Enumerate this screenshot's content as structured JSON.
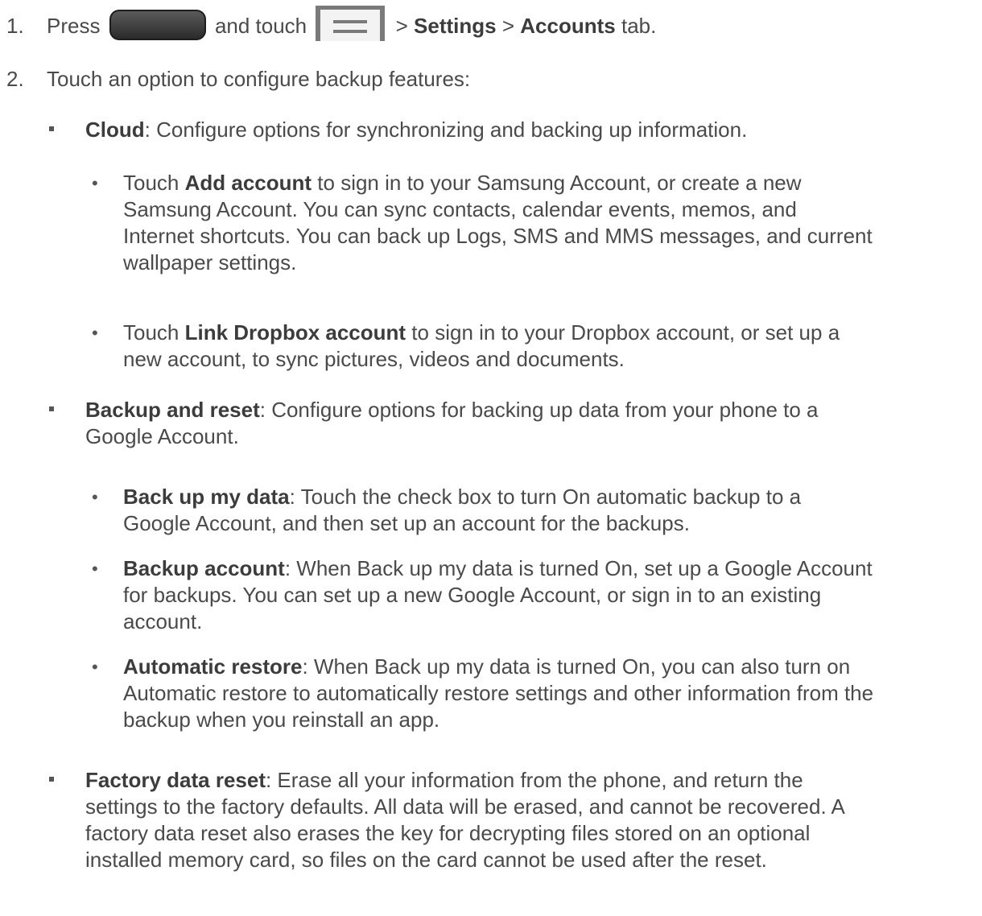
{
  "steps": [
    {
      "num": "1.",
      "parts": {
        "press": "Press",
        "and_touch": "and touch",
        "sep1": ">",
        "settings": "Settings",
        "sep2": ">",
        "accounts": "Accounts",
        "tab": "tab."
      },
      "icons": [
        "home-key-icon",
        "menu-icon"
      ]
    },
    {
      "num": "2.",
      "text": "Touch an option to configure backup features:"
    }
  ],
  "items": [
    {
      "title": "Cloud",
      "desc_lines": [
        ": Configure options for synchronizing and backing up information."
      ],
      "subitems": [
        {
          "pre": "Touch ",
          "bold": "Add account",
          "lines": [
            " to sign in to your Samsung Account, or create a new",
            "Samsung Account. You can sync contacts, calendar events, memos, and",
            "Internet shortcuts. You can back up Logs, SMS and MMS messages, and current",
            "wallpaper settings."
          ]
        },
        {
          "pre": "Touch ",
          "bold": "Link Dropbox account",
          "lines": [
            " to sign in to your Dropbox account, or set up a",
            "new account, to sync pictures, videos and documents."
          ]
        }
      ]
    },
    {
      "title": "Backup and reset",
      "desc_lines": [
        ": Configure options for backing up data from your phone to a",
        "Google Account."
      ],
      "subitems": [
        {
          "pre": "",
          "bold": "Back up my data",
          "lines": [
            ": Touch the check box to turn On automatic backup to a",
            "Google Account, and then set up an account for the backups."
          ]
        },
        {
          "pre": "",
          "bold": "Backup account",
          "lines": [
            ": When Back up my data is turned On, set up a Google Account",
            "for backups. You can set up a new Google Account, or sign in to an existing",
            "account."
          ]
        },
        {
          "pre": "",
          "bold": "Automatic restore",
          "lines": [
            ": When Back up my data is turned On, you can also turn on",
            "Automatic restore to automatically restore settings and other information from the",
            "backup when you reinstall an app."
          ]
        }
      ]
    },
    {
      "title": "Factory data reset",
      "desc_lines": [
        ": Erase all your information from the phone, and return the",
        "settings to the factory defaults. All data will be erased, and cannot be recovered. A",
        "factory data reset also erases the key for decrypting files stored on an optional",
        "installed memory card, so files on the card cannot be used after the reset."
      ],
      "subitems": []
    }
  ]
}
